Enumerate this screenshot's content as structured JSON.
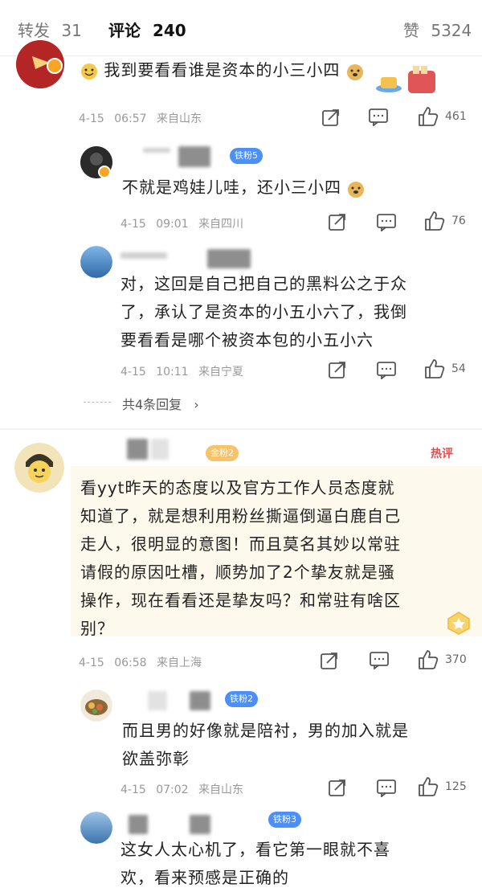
{
  "tabs": [
    {
      "label": "转发",
      "count": "31"
    },
    {
      "label": "评论",
      "count": "240"
    },
    {
      "label": "赞",
      "count": "5324"
    }
  ],
  "comments": [
    {
      "text": "我到要看看谁是资本的小三小四",
      "time": "4-15",
      "clock": "06:57",
      "location": "来自山东",
      "likes": "461"
    },
    {
      "badge": "铁粉5",
      "text": "不就是鸡娃儿哇，还小三小四",
      "time": "4-15",
      "clock": "09:01",
      "location": "来自四川",
      "likes": "76"
    },
    {
      "text_lines": [
        "对，这回是自己把自己的黑料公之于众",
        "了，承认了是资本的小五小六了，我倒",
        "要看看是哪个被资本包的小五小六"
      ],
      "time": "4-15",
      "clock": "10:11",
      "location": "来自宁夏",
      "likes": "54"
    },
    {
      "badge": "金粉2",
      "hot": "热评",
      "text_lines": [
        "看yyt昨天的态度以及官方工作人员态度就",
        "知道了，就是想利用粉丝撕逼倒逼白鹿自己",
        "走人，很明显的意图！而且莫名其妙以常驻",
        "请假的原因吐槽，顺势加了2个挚友就是骚",
        "操作，现在看看还是挚友吗？和常驻有啥区",
        "别？"
      ],
      "time": "4-15",
      "clock": "06:58",
      "location": "来自上海",
      "likes": "370"
    },
    {
      "badge": "铁粉2",
      "text_lines": [
        "而且男的好像就是陪衬，男的加入就是",
        "欲盖弥彰"
      ],
      "time": "4-15",
      "clock": "07:02",
      "location": "来自山东",
      "likes": "125"
    },
    {
      "badge": "铁粉3",
      "text_lines": [
        "这女人太心机了，看它第一眼就不喜",
        "欢，看来预感是正确的"
      ]
    }
  ],
  "replies_more": "共4条回复",
  "colors": {
    "accent": "#ff8200",
    "badge_blue": "#4b8ff7",
    "badge_gold": "#f6c36c",
    "hot": "#e84a4a"
  }
}
